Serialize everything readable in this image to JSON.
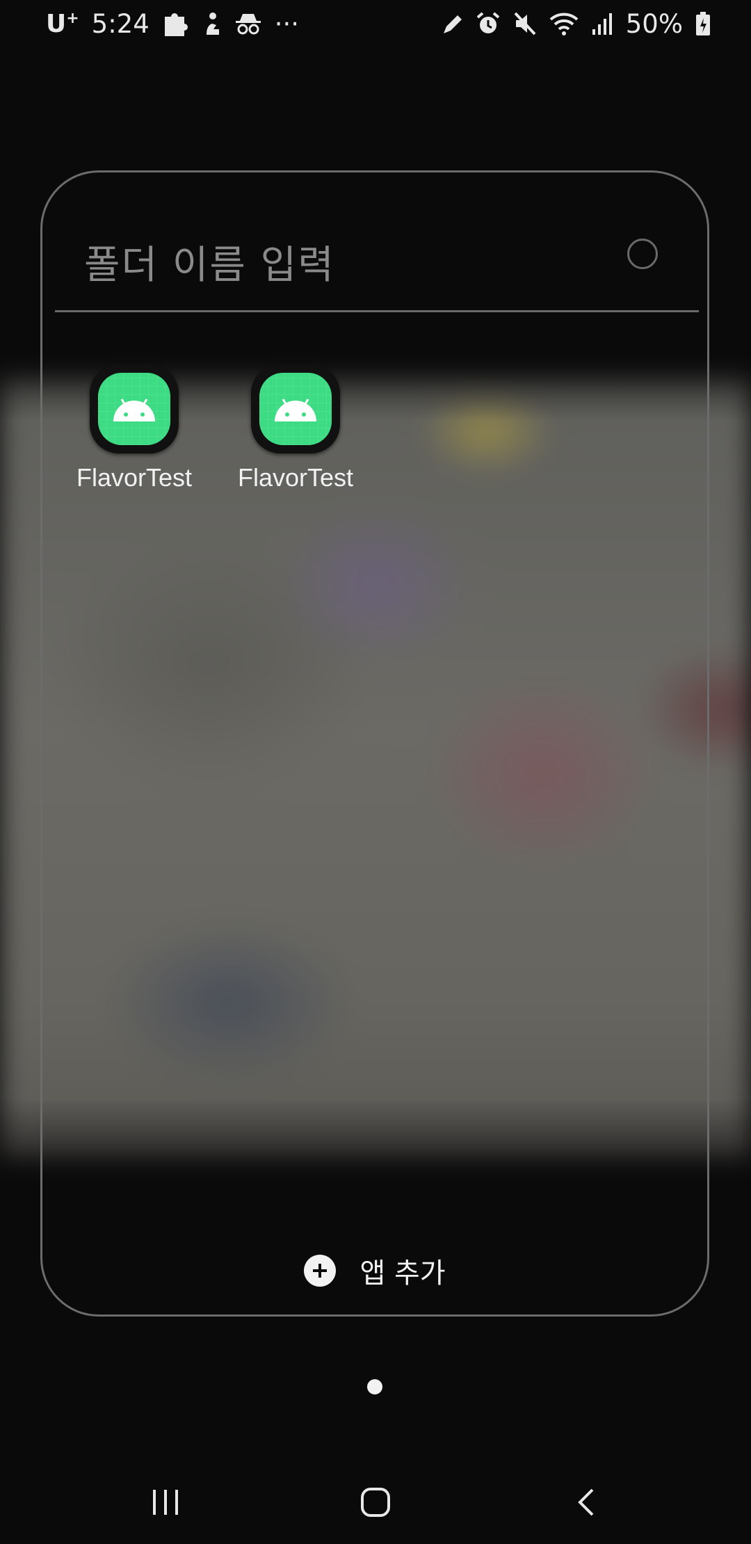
{
  "status_bar": {
    "carrier": "U",
    "carrier_superscript": "+",
    "time": "5:24",
    "more": "···",
    "battery_percent": "50%",
    "left_icons": [
      "puzzle-icon",
      "person-icon",
      "incognito-icon"
    ],
    "right_icons": [
      "pen-icon",
      "alarm-icon",
      "mute-icon",
      "wifi-icon",
      "signal-icon",
      "battery-icon"
    ]
  },
  "folder": {
    "name_placeholder": "폴더 이름 입력",
    "apps": [
      {
        "label": "FlavorTest",
        "icon": "android-icon"
      },
      {
        "label": "FlavorTest",
        "icon": "android-icon"
      }
    ],
    "add_apps_label": "앱 추가"
  },
  "pagination": {
    "current": 1,
    "total": 1
  },
  "nav_bar": {
    "buttons": [
      "recent-apps-icon",
      "home-icon",
      "back-icon"
    ]
  },
  "colors": {
    "background": "#0a0a0a",
    "android_green": "#3ddc84",
    "folder_border": "#6c6c6c"
  }
}
